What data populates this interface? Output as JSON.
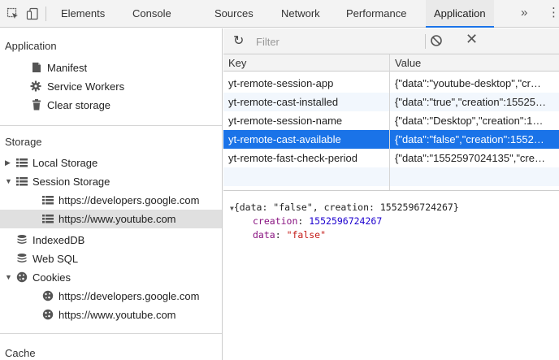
{
  "tabs": [
    "Elements",
    "Console",
    "Sources",
    "Network",
    "Performance",
    "Application"
  ],
  "more_tabs_glyph": "»",
  "menu_glyph": "⋮",
  "sidebar": {
    "application_header": "Application",
    "application_items": [
      "Manifest",
      "Service Workers",
      "Clear storage"
    ],
    "storage_header": "Storage",
    "local_storage": "Local Storage",
    "session_storage": "Session Storage",
    "session_children": [
      "https://developers.google.com",
      "https://www.youtube.com"
    ],
    "indexeddb": "IndexedDB",
    "websql": "Web SQL",
    "cookies": "Cookies",
    "cookie_children": [
      "https://developers.google.com",
      "https://www.youtube.com"
    ],
    "cache_header": "Cache"
  },
  "filter": {
    "placeholder": "Filter",
    "value": ""
  },
  "grid": {
    "headers": {
      "key": "Key",
      "value": "Value"
    },
    "rows": [
      {
        "key": "yt-remote-session-app",
        "value": "{\"data\":\"youtube-desktop\",\"cr…"
      },
      {
        "key": "yt-remote-cast-installed",
        "value": "{\"data\":\"true\",\"creation\":15525…"
      },
      {
        "key": "yt-remote-session-name",
        "value": "{\"data\":\"Desktop\",\"creation\":1…"
      },
      {
        "key": "yt-remote-cast-available",
        "value": "{\"data\":\"false\",\"creation\":1552…"
      },
      {
        "key": "yt-remote-fast-check-period",
        "value": "{\"data\":\"1552597024135\",\"cre…"
      }
    ],
    "selected_row": "yt-remote-cast-available"
  },
  "preview": {
    "summary": "{data: \"false\", creation: 1552596724267}",
    "creation_key": "creation",
    "creation_value": "1552596724267",
    "data_key": "data",
    "data_value": "\"false\""
  },
  "colors": {
    "accent": "#1a73e8",
    "selected_row_bg": "#1a73e8",
    "sidebar_selected_bg": "#e0e0e0"
  }
}
